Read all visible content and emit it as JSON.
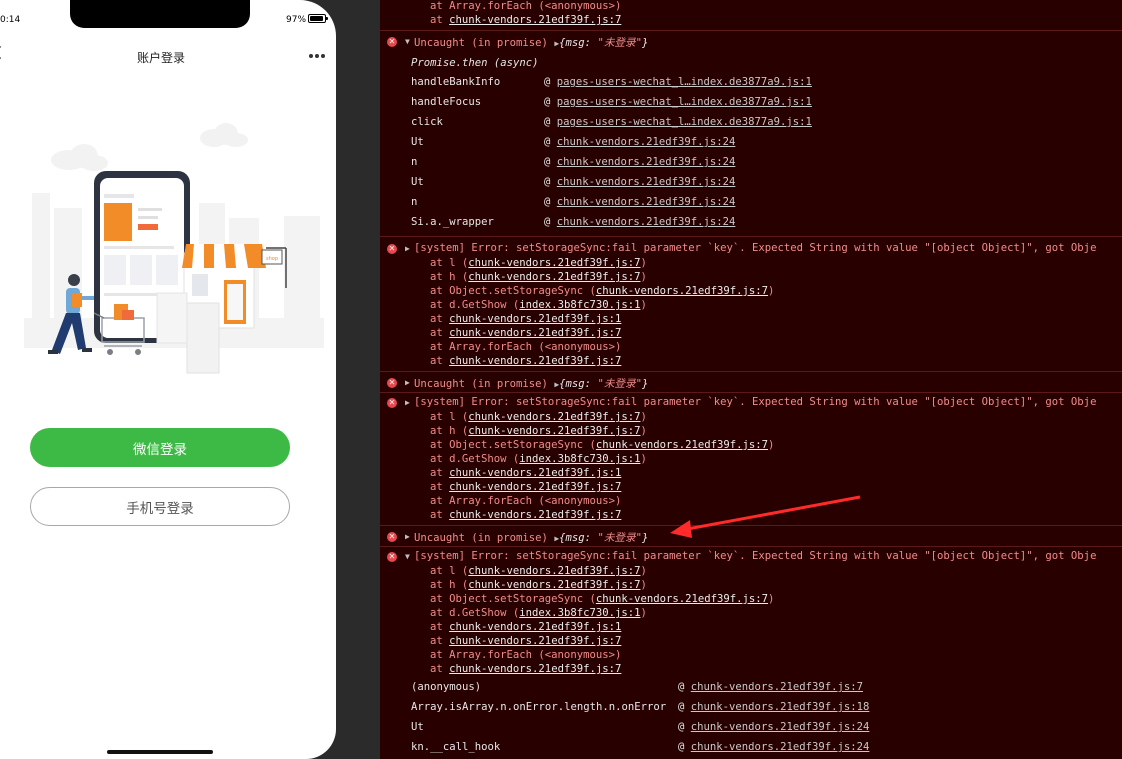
{
  "phone": {
    "time": "0:14",
    "battery": "97%",
    "nav_title": "账户登录",
    "wechat_login_label": "微信登录",
    "phone_login_label": "手机号登录",
    "illustration_sign": "shop",
    "accent_green": "#3cba45",
    "accent_orange": "#f28c28"
  },
  "console": {
    "top_stack": [
      {
        "prefix": "at Array.forEach (<anonymous>)",
        "link": ""
      },
      {
        "prefix": "at ",
        "link": "chunk-vendors.21edf39f.js:7"
      }
    ],
    "uncaught_label": "Uncaught (in promise)",
    "obj_open": "{msg: ",
    "obj_value": "\"未登录\"",
    "obj_close": "}",
    "promise_then": "Promise.then (async)",
    "frames1": [
      {
        "name": "handleBankInfo",
        "at": "@",
        "url": "pages-users-wechat_l…index.de3877a9.js:1"
      },
      {
        "name": "handleFocus",
        "at": "@",
        "url": "pages-users-wechat_l…index.de3877a9.js:1"
      },
      {
        "name": "click",
        "at": "@",
        "url": "pages-users-wechat_l…index.de3877a9.js:1"
      },
      {
        "name": "Ut",
        "at": "@",
        "url": "chunk-vendors.21edf39f.js:24"
      },
      {
        "name": "n",
        "at": "@",
        "url": "chunk-vendors.21edf39f.js:24"
      },
      {
        "name": "Ut",
        "at": "@",
        "url": "chunk-vendors.21edf39f.js:24"
      },
      {
        "name": "n",
        "at": "@",
        "url": "chunk-vendors.21edf39f.js:24"
      },
      {
        "name": "Si.a._wrapper",
        "at": "@",
        "url": "chunk-vendors.21edf39f.js:24"
      }
    ],
    "system_error": "[system] Error: setStorageSync:fail parameter `key`. Expected String with value \"[object Object]\", got Obje",
    "sys_stack": [
      {
        "pre": "at l (",
        "link": "chunk-vendors.21edf39f.js:7",
        "post": ")"
      },
      {
        "pre": "at h (",
        "link": "chunk-vendors.21edf39f.js:7",
        "post": ")"
      },
      {
        "pre": "at Object.setStorageSync (",
        "link": "chunk-vendors.21edf39f.js:7",
        "post": ")"
      },
      {
        "pre": "at d.GetShow (",
        "link": "index.3b8fc730.js:1",
        "post": ")"
      },
      {
        "pre": "at ",
        "link": "chunk-vendors.21edf39f.js:1",
        "post": ""
      },
      {
        "pre": "at ",
        "link": "chunk-vendors.21edf39f.js:7",
        "post": ""
      },
      {
        "pre": "at Array.forEach (<anonymous>)",
        "link": "",
        "post": ""
      },
      {
        "pre": "at ",
        "link": "chunk-vendors.21edf39f.js:7",
        "post": ""
      }
    ],
    "frames2": [
      {
        "name": "(anonymous)",
        "at": "@",
        "url": "chunk-vendors.21edf39f.js:7"
      },
      {
        "name": "Array.isArray.n.onError.length.n.onError",
        "at": "@",
        "url": "chunk-vendors.21edf39f.js:18"
      },
      {
        "name": "Ut",
        "at": "@",
        "url": "chunk-vendors.21edf39f.js:24"
      },
      {
        "name": "kn.__call_hook",
        "at": "@",
        "url": "chunk-vendors.21edf39f.js:24"
      }
    ],
    "error_color": "#f28b8b",
    "background": "#290000"
  }
}
